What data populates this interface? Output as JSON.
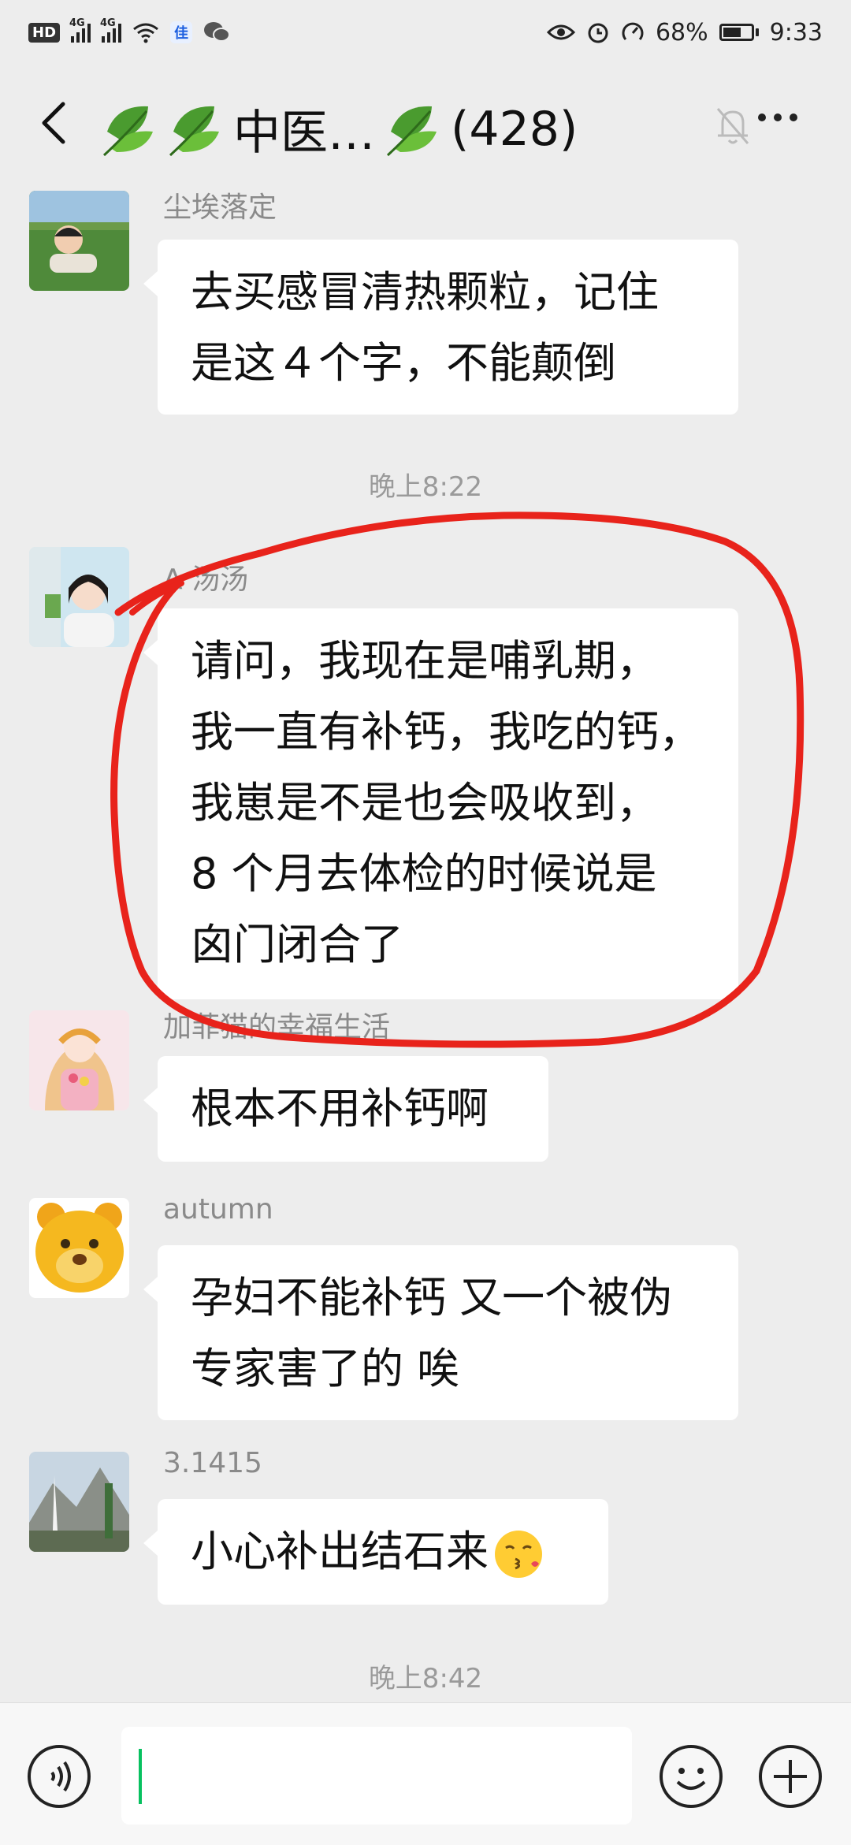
{
  "status_bar": {
    "hd": "HD",
    "sig1": "4G",
    "sig2": "4G",
    "battery": "68%",
    "time": "9:33"
  },
  "header": {
    "title": "中医…",
    "count": "(428)"
  },
  "messages": [
    {
      "sender": "尘埃落定",
      "lines": [
        "去买感冒清热颗粒，记住",
        "是这４个字，不能颠倒"
      ]
    },
    {
      "sender": "A 汤汤",
      "lines": [
        "请问，我现在是哺乳期，",
        "我一直有补钙，我吃的钙，",
        "我崽是不是也会吸收到，",
        "8 个月去体检的时候说是",
        "囟门闭合了"
      ]
    },
    {
      "sender": "加菲猫的幸福生活",
      "lines": [
        "根本不用补钙啊"
      ]
    },
    {
      "sender": "autumn",
      "lines": [
        "孕妇不能补钙 又一个被伪",
        "专家害了的 唉"
      ]
    },
    {
      "sender": "3.1415",
      "lines": [
        "小心补出结石来"
      ]
    }
  ],
  "timestamps": [
    "晚上8:22",
    "晚上8:42"
  ],
  "icons": {
    "back": "back-arrow-icon",
    "leaf": "leaf-icon",
    "mute": "bell-off-icon",
    "more": "more-dots-icon",
    "voice": "voice-icon",
    "emoji": "emoji-icon",
    "plus": "plus-icon",
    "sticker": "kissing-face-emoji"
  },
  "colors": {
    "background": "#ededed",
    "bubble": "#ffffff",
    "annotation": "#e8231b",
    "caret": "#07c160"
  }
}
